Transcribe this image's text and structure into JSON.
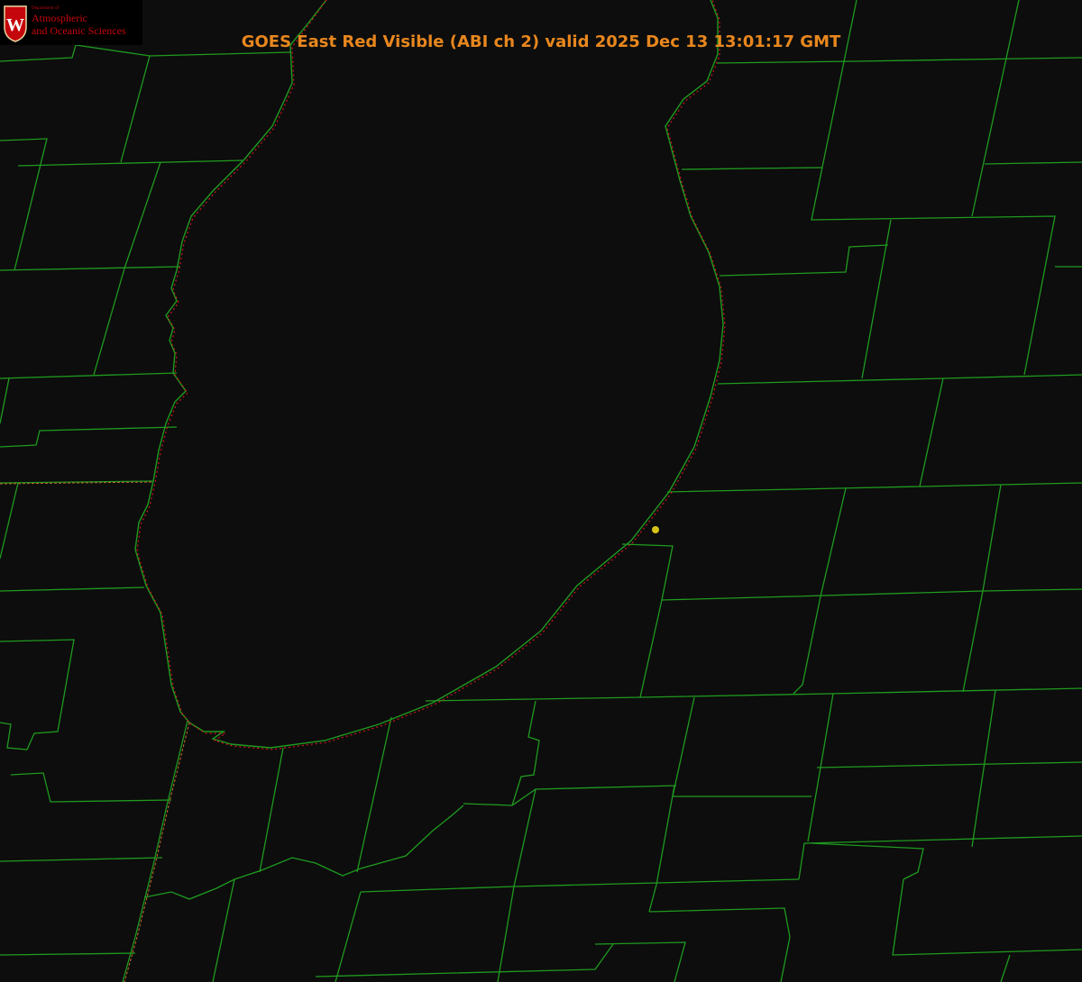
{
  "header": {
    "title": "GOES East Red Visible (ABI ch 2) valid 2025 Dec 13 13:01:17 GMT"
  },
  "logo": {
    "dept_label": "Department of",
    "line1": "Atmospheric",
    "line2": "and Oceanic Sciences",
    "crest_letter": "W"
  },
  "colors": {
    "background": "#0d0d0d",
    "county_lines": "#1f9a1f",
    "coastline_dotted": "#d0161a",
    "state_border": "#c46a2a",
    "title_text": "#e8871e",
    "marker": "#d8c417",
    "logo_red": "#c5050c"
  },
  "marker": {
    "icon": "location-dot-icon"
  }
}
